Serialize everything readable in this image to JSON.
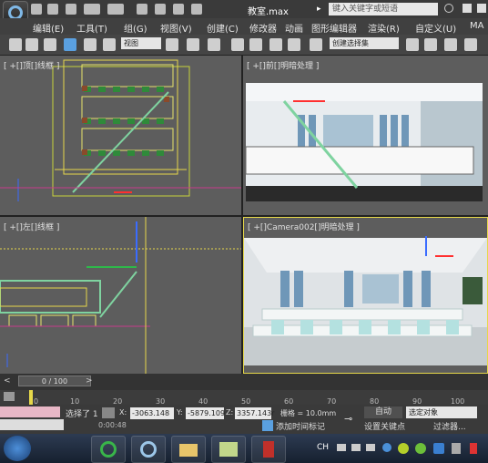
{
  "app": {
    "doc_title": "教室.max",
    "search_placeholder": "键入关键字或短语"
  },
  "menu": [
    "编辑(E)",
    "工具(T)",
    "组(G)",
    "视图(V)",
    "创建(C)",
    "修改器",
    "动画",
    "图形编辑器",
    "渲染(R)",
    "自定义(U)",
    "MA"
  ],
  "toolbar": {
    "view_dropdown": "视图",
    "selection_set": "创建选择集"
  },
  "viewports": {
    "top_left": "[ +[]顶[]线框 ]",
    "top_right": "[ +[]前[]明暗处理 ]",
    "bottom_left": "[ +[]左[]线框 ]",
    "bottom_right": "[ +[]Camera002[]明暗处理 ]"
  },
  "timeline": {
    "frame": "0 / 100"
  },
  "ruler_ticks": [
    "0",
    "10",
    "20",
    "30",
    "40",
    "50",
    "60",
    "70",
    "80",
    "90",
    "100"
  ],
  "status": {
    "selected": "选择了 1",
    "x_label": "X:",
    "x_value": "-3063.148",
    "y_label": "Y:",
    "y_value": "-5879.109",
    "z_label": "Z:",
    "z_value": "3357.143r",
    "grid": "栅格 = 10.0mm",
    "time": "0:00:48",
    "add_time_tag": "添加时间标记",
    "auto_key": "自动",
    "set_key": "设置关键点",
    "key_filter_dropdown": "选定对象",
    "filters": "过滤器..."
  },
  "taskbar": {
    "language": "CH"
  },
  "colors": {
    "accent_blue": "#5aa0e0",
    "viewport_bg": "#5d5d5d",
    "active_border": "#e6d84a"
  }
}
